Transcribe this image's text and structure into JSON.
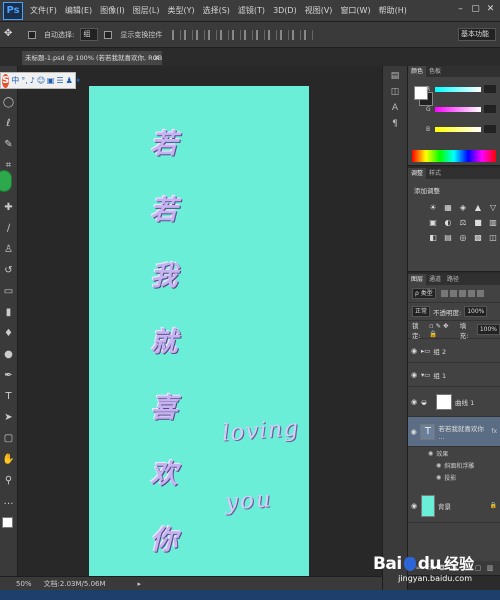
{
  "app": {
    "logo": "Ps",
    "menu": [
      "文件(F)",
      "编辑(E)",
      "图像(I)",
      "图层(L)",
      "类型(Y)",
      "选择(S)",
      "滤镜(T)",
      "3D(D)",
      "视图(V)",
      "窗口(W)",
      "帮助(H)"
    ],
    "window_controls": [
      "–",
      "▢",
      "✕"
    ]
  },
  "options_bar": {
    "auto_select_label": "自动选择:",
    "auto_select_value": "组",
    "show_transform_label": "显示变换控件",
    "workspace": "基本功能"
  },
  "document": {
    "tab_title": "未标题-1.psd @ 100% (若若我就喜欢你, RGB/8)",
    "close": "×"
  },
  "ime": {
    "logo": "S",
    "buttons": [
      "中",
      "°,",
      "♪",
      "☺",
      "▣",
      "☰",
      "♟",
      "✦"
    ]
  },
  "canvas": {
    "bg_color": "#6aeed8",
    "vertical_chars": [
      "若",
      "若",
      "我",
      "就",
      "喜",
      "欢",
      "你"
    ],
    "line1": "loving",
    "line2": "you"
  },
  "status": {
    "zoom": "50%",
    "doc": "文档:2.03M/5.06M",
    "arrow": "▸"
  },
  "color_panel": {
    "tabs": [
      "颜色",
      "色板"
    ],
    "sliders": [
      {
        "label": "R",
        "value": "",
        "color": "linear-gradient(90deg,#00ffff,#ffffff)"
      },
      {
        "label": "G",
        "value": "",
        "color": "linear-gradient(90deg,#ff00ff,#ffffff)"
      },
      {
        "label": "B",
        "value": "",
        "color": "linear-gradient(90deg,#ffff00,#ffffff)"
      }
    ]
  },
  "adjustments_panel": {
    "tabs": [
      "调整",
      "样式"
    ],
    "title": "添加调整",
    "icons": [
      "☀",
      "▦",
      "◈",
      "▲",
      "▽",
      "▣",
      "◐",
      "⚖",
      "■",
      "▥",
      "◧",
      "▤",
      "◎",
      "▩",
      "◫"
    ]
  },
  "layers_panel": {
    "tabs": [
      "图层",
      "通道",
      "路径"
    ],
    "kind_label": "ρ 类型",
    "blend_mode": "正常",
    "opacity_label": "不透明度:",
    "opacity_value": "100%",
    "lock_label": "锁定:",
    "fill_label": "填充:",
    "fill_value": "100%",
    "layers": [
      {
        "name": "组 2",
        "type": "group"
      },
      {
        "name": "组 1",
        "type": "group"
      },
      {
        "name": "曲线 1",
        "type": "adjustment"
      },
      {
        "name": "若若我就喜欢你 ...",
        "type": "text"
      },
      {
        "name": "效果",
        "type": "effect"
      },
      {
        "name": "斜面和浮雕",
        "type": "effect"
      },
      {
        "name": "投影",
        "type": "effect"
      },
      {
        "name": "背景",
        "type": "background"
      }
    ]
  },
  "watermark": {
    "brand": "Bai",
    "brand2": "du",
    "text": "经验",
    "url": "jingyan.baidu.com"
  }
}
